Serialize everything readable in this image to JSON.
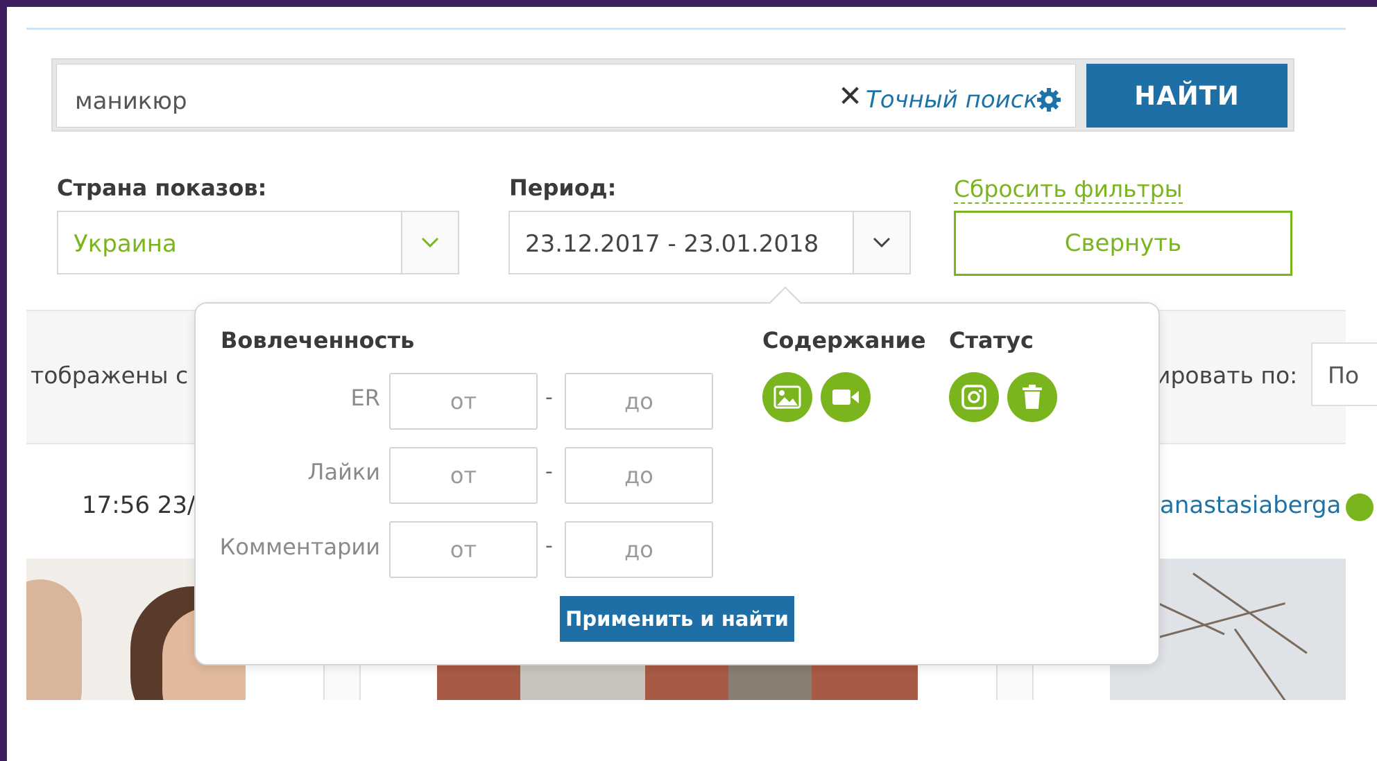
{
  "search": {
    "value": "маникюр",
    "clear_symbol": "✕",
    "exact_label": "Точный поиск",
    "find_label": "НАЙТИ"
  },
  "filters": {
    "country_label": "Страна показов:",
    "country_value": "Украина",
    "period_label": "Период:",
    "period_value": "23.12.2017 - 23.01.2018",
    "reset_label": "Сбросить фильтры",
    "collapse_label": "Свернуть"
  },
  "background": {
    "shown_text": "тображены с",
    "sort_text": "ировать по:",
    "sort_value": "По",
    "time_text": "17:56 23/",
    "username": "anastasiaberga"
  },
  "popup": {
    "engagement_title": "Вовлеченность",
    "content_title": "Содержание",
    "status_title": "Статус",
    "rows": [
      {
        "label": "ER",
        "from": "от",
        "to": "до"
      },
      {
        "label": "Лайки",
        "from": "от",
        "to": "до"
      },
      {
        "label": "Комментарии",
        "from": "от",
        "to": "до"
      }
    ],
    "dash": "-",
    "apply_label": "Применить и найти",
    "content_icons": [
      "image-icon",
      "video-icon"
    ],
    "status_icons": [
      "instagram-icon",
      "trash-icon"
    ]
  },
  "colors": {
    "accent_blue": "#1d6fa5",
    "accent_green": "#7ab51d",
    "link_blue": "#1d73a8"
  }
}
